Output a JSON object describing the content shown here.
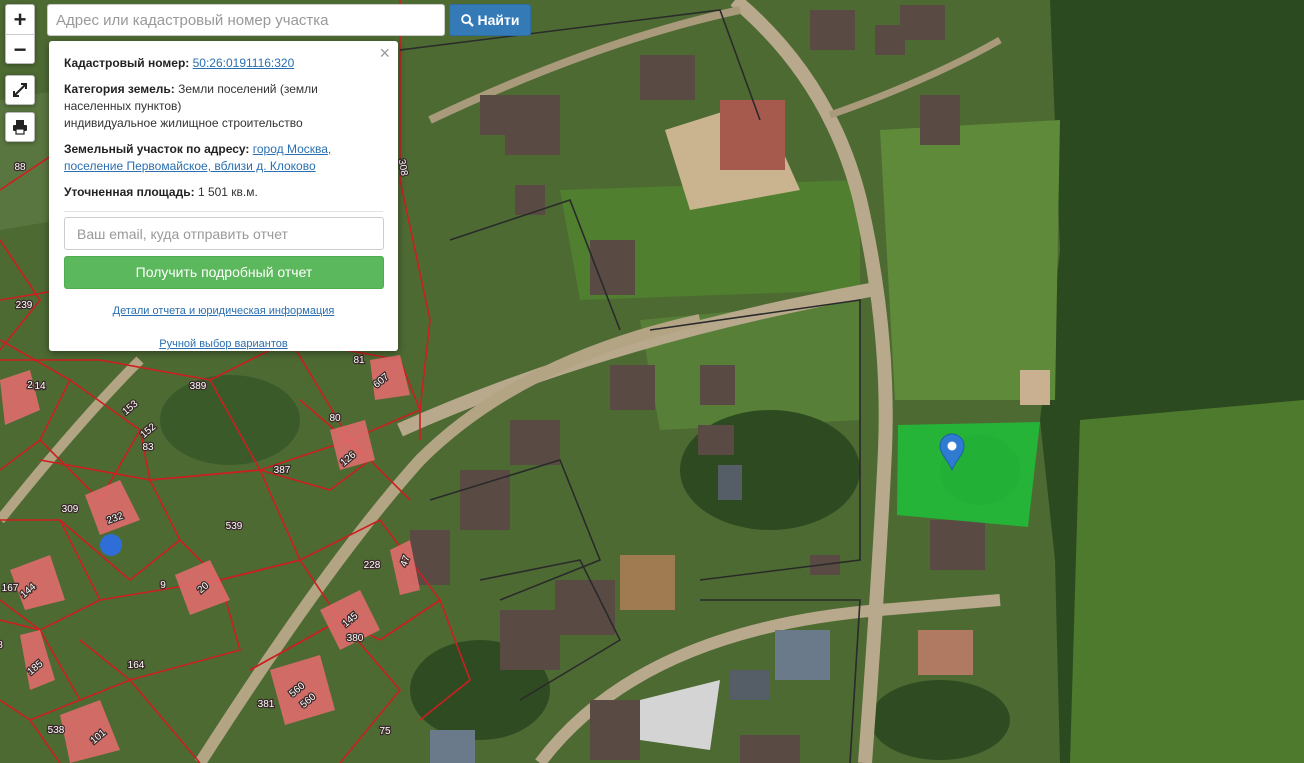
{
  "map": {
    "zoom_in": "+",
    "zoom_out": "−",
    "fullscreen_icon": "expand-icon",
    "print_icon": "print-icon",
    "marker_icon": "map-pin-icon",
    "plot_color": "#1fbf3a",
    "parcel_color": "#e06b6b",
    "boundary_color": "#cc1f1f",
    "parcel_numbers": [
      "14",
      "88",
      "239",
      "2",
      "153",
      "152",
      "83",
      "389",
      "81",
      "607",
      "80",
      "126",
      "387",
      "309",
      "232",
      "539",
      "167",
      "144",
      "9",
      "20",
      "228",
      "47",
      "145",
      "380",
      "164",
      "185",
      "381",
      "560",
      "560",
      "538",
      "101",
      "75",
      "8",
      "308"
    ]
  },
  "search": {
    "placeholder": "Адрес или кадастровый номер участка",
    "button_label": "Найти",
    "button_icon": "search-icon"
  },
  "popup": {
    "cadastral_label": "Кадастровый номер:",
    "cadastral_value": "50:26:0191116:320",
    "category_label": "Категория земель:",
    "category_value_1": "Земли поселений (земли",
    "category_value_2": "населенных пунктов)",
    "category_value_3": "индивидуальное жилищное строительство",
    "address_label": "Земельный участок по адресу:",
    "address_value_1": "город Москва,",
    "address_value_2": "поселение Первомайское, вблизи д. Клоково",
    "area_label": "Уточненная площадь:",
    "area_value": "1 501 кв.м.",
    "email_placeholder": "Ваш email, куда отправить отчет",
    "report_button": "Получить подробный отчет",
    "details_link": "Детали отчета и юридическая информация",
    "manual_link": "Ручной выбор вариантов",
    "close": "×"
  }
}
